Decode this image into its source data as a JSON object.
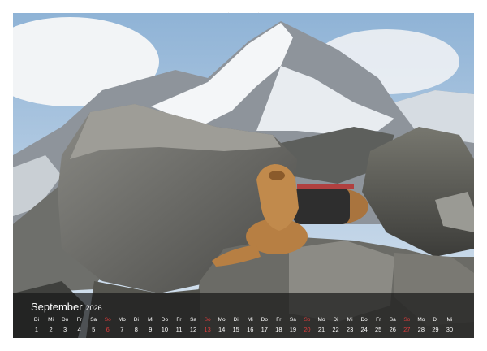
{
  "calendar": {
    "month": "September",
    "year": "2026",
    "days": [
      {
        "wd": "Di",
        "d": "1",
        "sun": false
      },
      {
        "wd": "Mi",
        "d": "2",
        "sun": false
      },
      {
        "wd": "Do",
        "d": "3",
        "sun": false
      },
      {
        "wd": "Fr",
        "d": "4",
        "sun": false
      },
      {
        "wd": "Sa",
        "d": "5",
        "sun": false
      },
      {
        "wd": "So",
        "d": "6",
        "sun": true
      },
      {
        "wd": "Mo",
        "d": "7",
        "sun": false
      },
      {
        "wd": "Di",
        "d": "8",
        "sun": false
      },
      {
        "wd": "Mi",
        "d": "9",
        "sun": false
      },
      {
        "wd": "Do",
        "d": "10",
        "sun": false
      },
      {
        "wd": "Fr",
        "d": "11",
        "sun": false
      },
      {
        "wd": "Sa",
        "d": "12",
        "sun": false
      },
      {
        "wd": "So",
        "d": "13",
        "sun": true
      },
      {
        "wd": "Mo",
        "d": "14",
        "sun": false
      },
      {
        "wd": "Di",
        "d": "15",
        "sun": false
      },
      {
        "wd": "Mi",
        "d": "16",
        "sun": false
      },
      {
        "wd": "Do",
        "d": "17",
        "sun": false
      },
      {
        "wd": "Fr",
        "d": "18",
        "sun": false
      },
      {
        "wd": "Sa",
        "d": "19",
        "sun": false
      },
      {
        "wd": "So",
        "d": "20",
        "sun": true
      },
      {
        "wd": "Mo",
        "d": "21",
        "sun": false
      },
      {
        "wd": "Di",
        "d": "22",
        "sun": false
      },
      {
        "wd": "Mi",
        "d": "23",
        "sun": false
      },
      {
        "wd": "Do",
        "d": "24",
        "sun": false
      },
      {
        "wd": "Fr",
        "d": "25",
        "sun": false
      },
      {
        "wd": "Sa",
        "d": "26",
        "sun": false
      },
      {
        "wd": "So",
        "d": "27",
        "sun": true
      },
      {
        "wd": "Mo",
        "d": "28",
        "sun": false
      },
      {
        "wd": "Di",
        "d": "29",
        "sun": false
      },
      {
        "wd": "Mi",
        "d": "30",
        "sun": false
      }
    ]
  },
  "colors": {
    "sunday": "#e03c3c",
    "text": "#ffffff",
    "bar": "#191919"
  }
}
